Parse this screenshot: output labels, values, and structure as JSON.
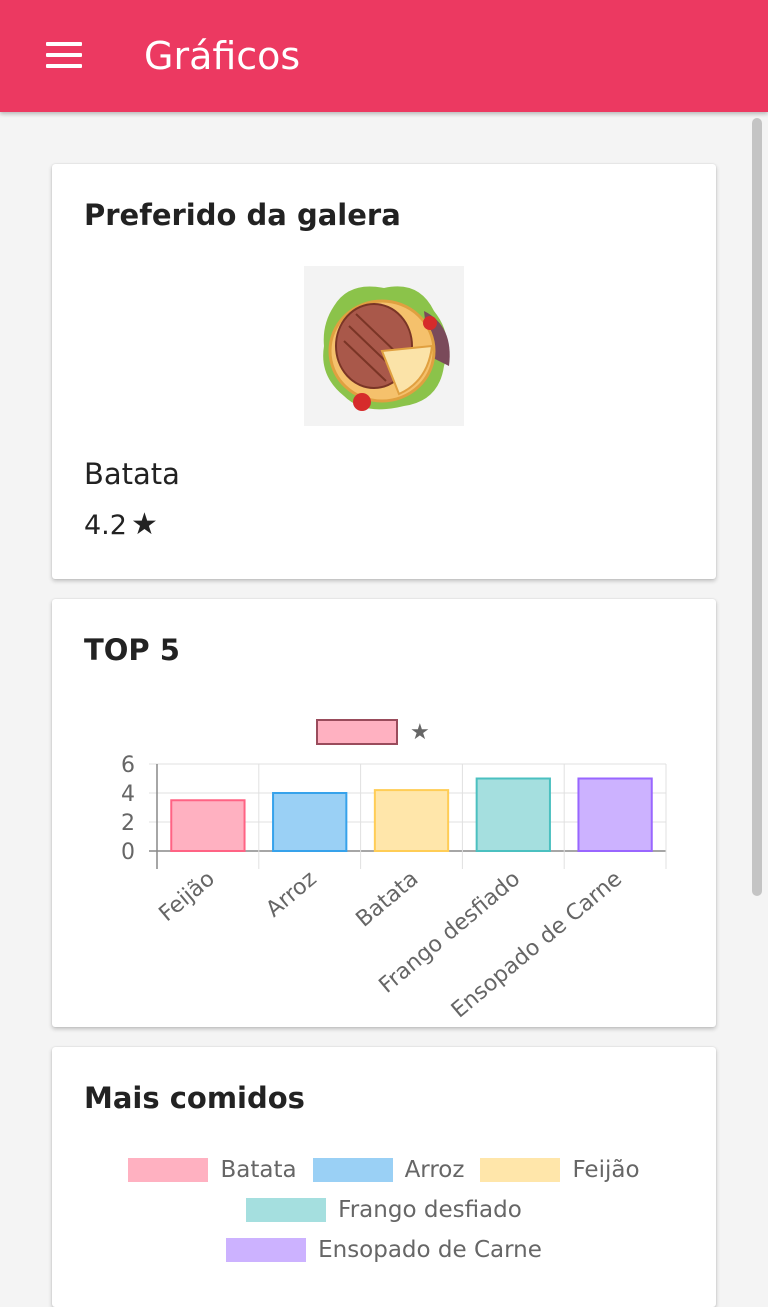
{
  "appbar": {
    "title": "Gráficos",
    "menu_icon": "hamburger-menu-icon",
    "color": "#ec3961"
  },
  "favorite": {
    "title": "Preferido da galera",
    "image_icon": "steak-salad-illustration",
    "name": "Batata",
    "rating": "4.2",
    "rating_icon": "★"
  },
  "top5": {
    "title": "TOP 5"
  },
  "chart_data": [
    {
      "type": "bar",
      "legend": [
        {
          "label": "★",
          "color": "#ffb1c1",
          "border": "#9a4c5c"
        }
      ],
      "categories": [
        "Feijão",
        "Arroz",
        "Batata",
        "Frango desfiado",
        "Ensopado de Carne"
      ],
      "values": [
        3.5,
        4.0,
        4.2,
        5.0,
        5.0
      ],
      "colors": [
        "#ffb1c1",
        "#9ad0f5",
        "#ffe6aa",
        "#a5dfdf",
        "#ccb2ff"
      ],
      "borders": [
        "#ff6384",
        "#36a2eb",
        "#ffcd56",
        "#4bc0c0",
        "#9966ff"
      ],
      "ylim": [
        0,
        6
      ],
      "yticks": [
        0,
        2,
        4,
        6
      ],
      "grid": true
    },
    {
      "type": "pie",
      "legend": [
        {
          "label": "Batata",
          "color": "#ffb1c1"
        },
        {
          "label": "Arroz",
          "color": "#9ad0f5"
        },
        {
          "label": "Feijão",
          "color": "#ffe6aa"
        },
        {
          "label": "Frango desfiado",
          "color": "#a5dfdf"
        },
        {
          "label": "Ensopado de Carne",
          "color": "#ccb2ff"
        }
      ]
    }
  ],
  "most_eaten": {
    "title": "Mais comidos"
  }
}
